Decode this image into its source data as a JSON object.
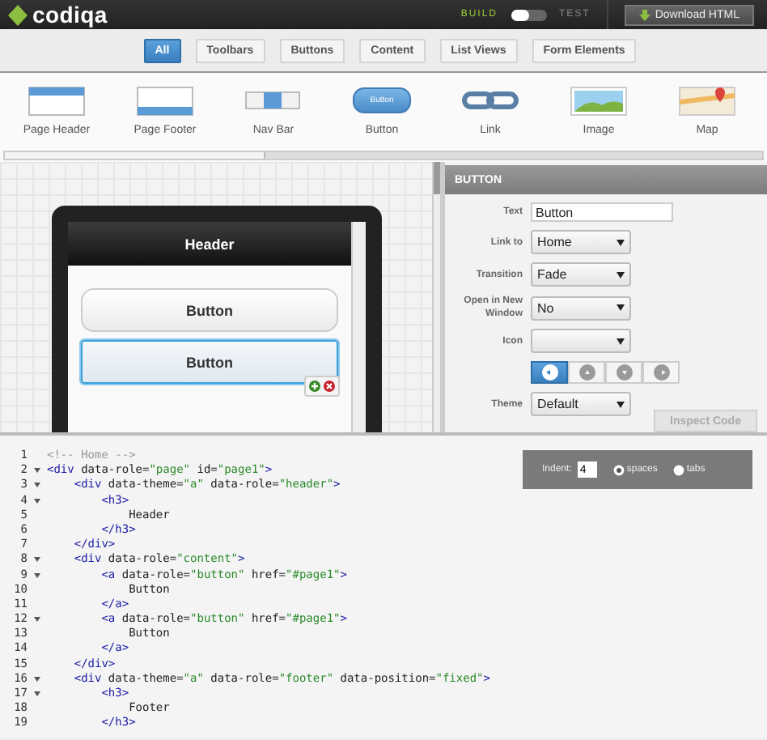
{
  "app": {
    "logo": "codiqa",
    "modes": [
      {
        "label": "BUILD",
        "selected": true
      },
      {
        "label": "TEST",
        "selected": false
      }
    ],
    "download_button": "Download HTML"
  },
  "filters": [
    {
      "label": "All",
      "selected": true
    },
    {
      "label": "Toolbars",
      "selected": false
    },
    {
      "label": "Buttons",
      "selected": false
    },
    {
      "label": "Content",
      "selected": false
    },
    {
      "label": "List Views",
      "selected": false
    },
    {
      "label": "Form Elements",
      "selected": false
    }
  ],
  "palette": [
    {
      "kind": "page-header",
      "label": "Page Header"
    },
    {
      "kind": "page-footer",
      "label": "Page Footer"
    },
    {
      "kind": "nav-bar",
      "label": "Nav Bar"
    },
    {
      "kind": "button",
      "label": "Button",
      "preview_text": "Button"
    },
    {
      "kind": "link",
      "label": "Link"
    },
    {
      "kind": "image",
      "label": "Image"
    },
    {
      "kind": "map",
      "label": "Map"
    }
  ],
  "preview": {
    "header": "Header",
    "buttons": [
      {
        "label": "Button",
        "selected": false
      },
      {
        "label": "Button",
        "selected": true
      }
    ]
  },
  "properties": {
    "title": "BUTTON",
    "fields": [
      {
        "kind": "text",
        "label": "Text",
        "value": "Button"
      },
      {
        "kind": "select",
        "label": "Link to",
        "value": "Home"
      },
      {
        "kind": "select",
        "label": "Transition",
        "value": "Fade"
      },
      {
        "kind": "select",
        "label": "Open in New Window",
        "value": "No"
      },
      {
        "kind": "select",
        "label": "Icon"
      },
      {
        "kind": "segmented",
        "options": [
          {
            "kind": "left",
            "selected": true
          },
          {
            "kind": "up",
            "selected": false
          },
          {
            "kind": "down",
            "selected": false
          },
          {
            "kind": "right",
            "selected": false
          }
        ]
      },
      {
        "kind": "select",
        "label": "Theme",
        "value": "Default"
      }
    ],
    "inspect_button": "Inspect Code"
  },
  "editor": {
    "indent": {
      "label": "Indent:",
      "value": "4",
      "options": [
        {
          "label": "spaces",
          "selected": true
        },
        {
          "label": "tabs",
          "selected": false
        }
      ]
    },
    "lines": [
      {
        "number": "1",
        "foldable": false,
        "tokens": [
          {
            "kind": "comment",
            "text": "<!-- Home -->"
          }
        ]
      },
      {
        "number": "2",
        "foldable": true,
        "tokens": [
          {
            "kind": "tag",
            "text": "<div"
          },
          {
            "kind": "attr",
            "text": " data-role="
          },
          {
            "kind": "value",
            "text": "\"page\""
          },
          {
            "kind": "attr",
            "text": " id="
          },
          {
            "kind": "value",
            "text": "\"page1\""
          },
          {
            "kind": "tag",
            "text": ">"
          }
        ]
      },
      {
        "number": "3",
        "foldable": true,
        "tokens": [
          {
            "kind": "tag",
            "text": "    <div"
          },
          {
            "kind": "attr",
            "text": " data-theme="
          },
          {
            "kind": "value",
            "text": "\"a\""
          },
          {
            "kind": "attr",
            "text": " data-role="
          },
          {
            "kind": "value",
            "text": "\"header\""
          },
          {
            "kind": "tag",
            "text": ">"
          }
        ]
      },
      {
        "number": "4",
        "foldable": true,
        "tokens": [
          {
            "kind": "tag",
            "text": "        <h3>"
          }
        ]
      },
      {
        "number": "5",
        "foldable": false,
        "tokens": [
          {
            "kind": "text",
            "text": "            Header"
          }
        ]
      },
      {
        "number": "6",
        "foldable": false,
        "tokens": [
          {
            "kind": "tag",
            "text": "        </h3>"
          }
        ]
      },
      {
        "number": "7",
        "foldable": false,
        "tokens": [
          {
            "kind": "tag",
            "text": "    </div>"
          }
        ]
      },
      {
        "number": "8",
        "foldable": true,
        "tokens": [
          {
            "kind": "tag",
            "text": "    <div"
          },
          {
            "kind": "attr",
            "text": " data-role="
          },
          {
            "kind": "value",
            "text": "\"content\""
          },
          {
            "kind": "tag",
            "text": ">"
          }
        ]
      },
      {
        "number": "9",
        "foldable": true,
        "tokens": [
          {
            "kind": "tag",
            "text": "        <a"
          },
          {
            "kind": "attr",
            "text": " data-role="
          },
          {
            "kind": "value",
            "text": "\"button\""
          },
          {
            "kind": "attr",
            "text": " href="
          },
          {
            "kind": "value",
            "text": "\"#page1\""
          },
          {
            "kind": "tag",
            "text": ">"
          }
        ]
      },
      {
        "number": "10",
        "foldable": false,
        "tokens": [
          {
            "kind": "text",
            "text": "            Button"
          }
        ]
      },
      {
        "number": "11",
        "foldable": false,
        "tokens": [
          {
            "kind": "tag",
            "text": "        </a>"
          }
        ]
      },
      {
        "number": "12",
        "foldable": true,
        "tokens": [
          {
            "kind": "tag",
            "text": "        <a"
          },
          {
            "kind": "attr",
            "text": " data-role="
          },
          {
            "kind": "value",
            "text": "\"button\""
          },
          {
            "kind": "attr",
            "text": " href="
          },
          {
            "kind": "value",
            "text": "\"#page1\""
          },
          {
            "kind": "tag",
            "text": ">"
          }
        ]
      },
      {
        "number": "13",
        "foldable": false,
        "tokens": [
          {
            "kind": "text",
            "text": "            Button"
          }
        ]
      },
      {
        "number": "14",
        "foldable": false,
        "tokens": [
          {
            "kind": "tag",
            "text": "        </a>"
          }
        ]
      },
      {
        "number": "15",
        "foldable": false,
        "tokens": [
          {
            "kind": "tag",
            "text": "    </div>"
          }
        ]
      },
      {
        "number": "16",
        "foldable": true,
        "tokens": [
          {
            "kind": "tag",
            "text": "    <div"
          },
          {
            "kind": "attr",
            "text": " data-theme="
          },
          {
            "kind": "value",
            "text": "\"a\""
          },
          {
            "kind": "attr",
            "text": " data-role="
          },
          {
            "kind": "value",
            "text": "\"footer\""
          },
          {
            "kind": "attr",
            "text": " data-position="
          },
          {
            "kind": "value",
            "text": "\"fixed\""
          },
          {
            "kind": "tag",
            "text": ">"
          }
        ]
      },
      {
        "number": "17",
        "foldable": true,
        "tokens": [
          {
            "kind": "tag",
            "text": "        <h3>"
          }
        ]
      },
      {
        "number": "18",
        "foldable": false,
        "tokens": [
          {
            "kind": "text",
            "text": "            Footer"
          }
        ]
      },
      {
        "number": "19",
        "foldable": false,
        "tokens": [
          {
            "kind": "tag",
            "text": "        </h3>"
          }
        ]
      }
    ]
  }
}
